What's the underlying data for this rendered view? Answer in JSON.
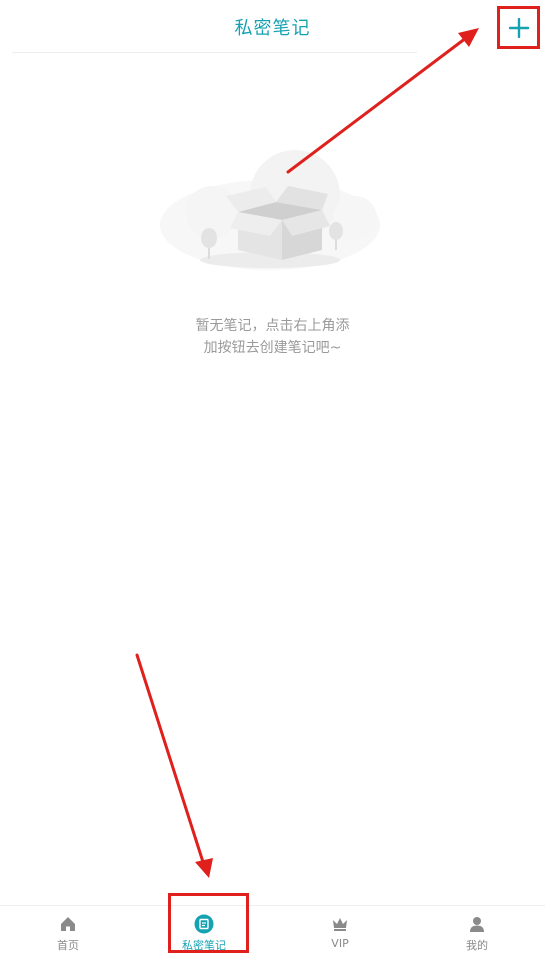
{
  "header": {
    "title": "私密笔记",
    "add_icon": "plus-icon"
  },
  "empty_state": {
    "illustration": "empty-box-illustration",
    "line1": "暂无笔记，点击右上角添",
    "line2": "加按钮去创建笔记吧~"
  },
  "tabbar": {
    "items": [
      {
        "label": "首页",
        "icon": "home-icon",
        "active": false
      },
      {
        "label": "私密笔记",
        "icon": "note-icon",
        "active": true
      },
      {
        "label": "VIP",
        "icon": "crown-icon",
        "active": false
      },
      {
        "label": "我的",
        "icon": "user-icon",
        "active": false
      }
    ]
  },
  "colors": {
    "accent": "#17a2b2",
    "annotation_red": "#e0201c",
    "inactive": "#8a8a8a",
    "placeholder_text": "#9a9a9a"
  }
}
